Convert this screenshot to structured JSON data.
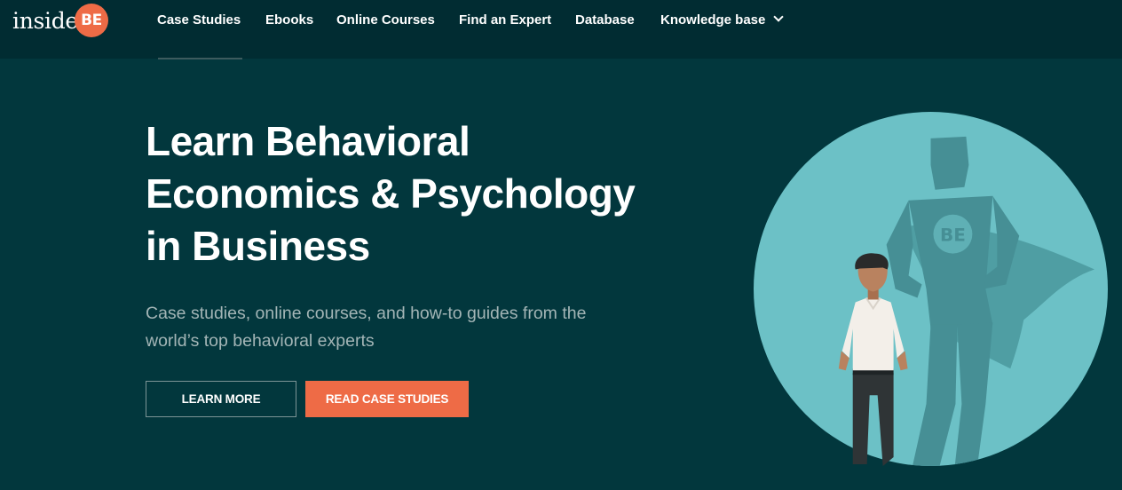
{
  "header": {
    "logo": {
      "text": "inside",
      "badge": "BE"
    },
    "nav": [
      {
        "label": "Case Studies"
      },
      {
        "label": "Ebooks"
      },
      {
        "label": "Online Courses"
      },
      {
        "label": "Find an Expert"
      },
      {
        "label": "Database"
      },
      {
        "label": "Knowledge base",
        "dropdown_icon": "chevron-down-icon"
      }
    ]
  },
  "hero": {
    "title_lines": [
      "Learn Behavioral",
      "Economics & Psychology",
      "in Business"
    ],
    "subtitle_lines": [
      "Case studies, online courses, and how-to guides from the",
      "world’s top behavioral experts"
    ],
    "buttons": {
      "learn_more": "LEARN MORE",
      "read_case_studies": "READ CASE STUDIES"
    },
    "illustration": {
      "shadow_badge": "BE"
    }
  },
  "colors": {
    "background": "#02373d",
    "header_background": "#012c32",
    "accent": "#ee6b46",
    "subtitle_text": "#a3b5b6",
    "illustration_circle": "#6cc1c6"
  }
}
